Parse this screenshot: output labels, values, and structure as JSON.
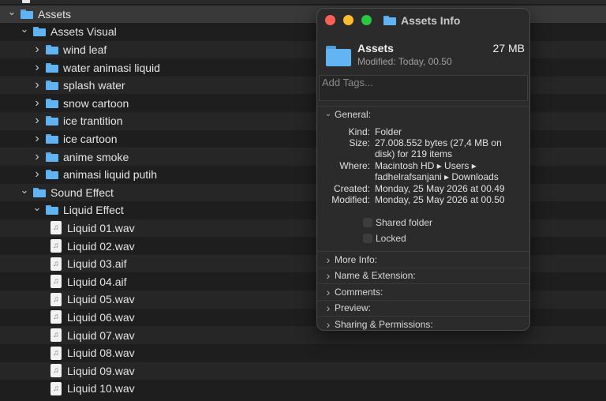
{
  "list": {
    "rows": [
      {
        "type": "folder",
        "label": "Assets",
        "expanded": true,
        "indent": 0
      },
      {
        "type": "folder",
        "label": "Assets Visual",
        "expanded": true,
        "indent": 1
      },
      {
        "type": "folder",
        "label": "wind leaf",
        "expanded": false,
        "indent": 2
      },
      {
        "type": "folder",
        "label": "water animasi liquid",
        "expanded": false,
        "indent": 2
      },
      {
        "type": "folder",
        "label": "splash water",
        "expanded": false,
        "indent": 2
      },
      {
        "type": "folder",
        "label": "snow cartoon",
        "expanded": false,
        "indent": 2
      },
      {
        "type": "folder",
        "label": "ice trantition",
        "expanded": false,
        "indent": 2
      },
      {
        "type": "folder",
        "label": "ice cartoon",
        "expanded": false,
        "indent": 2
      },
      {
        "type": "folder",
        "label": "anime smoke",
        "expanded": false,
        "indent": 2
      },
      {
        "type": "folder",
        "label": "animasi liquid putih",
        "expanded": false,
        "indent": 2
      },
      {
        "type": "folder",
        "label": "Sound Effect",
        "expanded": true,
        "indent": 1
      },
      {
        "type": "folder",
        "label": "Liquid Effect",
        "expanded": true,
        "indent": 2
      },
      {
        "type": "file",
        "label": "Liquid 01.wav",
        "indent": 3
      },
      {
        "type": "file",
        "label": "Liquid 02.wav",
        "indent": 3
      },
      {
        "type": "file",
        "label": "Liquid 03.aif",
        "indent": 3
      },
      {
        "type": "file",
        "label": "Liquid 04.aif",
        "indent": 3
      },
      {
        "type": "file",
        "label": "Liquid 05.wav",
        "indent": 3
      },
      {
        "type": "file",
        "label": "Liquid 06.wav",
        "indent": 3
      },
      {
        "type": "file",
        "label": "Liquid 07.wav",
        "indent": 3
      },
      {
        "type": "file",
        "label": "Liquid 08.wav",
        "indent": 3
      },
      {
        "type": "file",
        "label": "Liquid 09.wav",
        "indent": 3
      },
      {
        "type": "file",
        "label": "Liquid 10.wav",
        "indent": 3
      }
    ]
  },
  "info": {
    "window_title": "Assets Info",
    "name": "Assets",
    "size_short": "27 MB",
    "modified_short": "Modified: Today, 00.50",
    "tags_placeholder": "Add Tags...",
    "general_label": "General:",
    "kind_label": "Kind:",
    "kind_value": "Folder",
    "size_label": "Size:",
    "size_value_1": "27.008.552 bytes (27,4 MB on",
    "size_value_2": "disk) for 219 items",
    "where_label": "Where:",
    "where_value_1": "Macintosh HD ▸ Users ▸",
    "where_value_2": "fadhelrafsanjani ▸ Downloads",
    "created_label": "Created:",
    "created_value": "Monday, 25 May 2026 at 00.49",
    "modified_label": "Modified:",
    "modified_value": "Monday, 25 May 2026 at 00.50",
    "shared_folder_label": "Shared folder",
    "locked_label": "Locked",
    "sections": [
      "More Info:",
      "Name & Extension:",
      "Comments:",
      "Preview:",
      "Sharing & Permissions:"
    ]
  },
  "colors": {
    "folder": "#61b3f2",
    "close": "#ff5f57",
    "minimize": "#febc2e",
    "zoom": "#28c840"
  }
}
